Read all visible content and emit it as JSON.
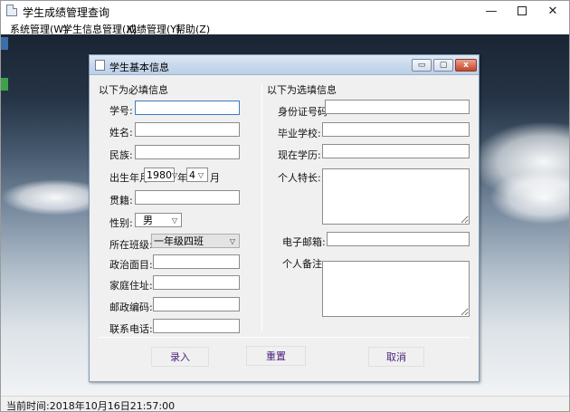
{
  "window": {
    "title": "学生成绩管理查询",
    "min_glyph": "—",
    "close_glyph": "✕"
  },
  "menu": [
    {
      "label": "系统管理(W)"
    },
    {
      "label": "学生信息管理(X)"
    },
    {
      "label": "成绩管理(Y)"
    },
    {
      "label": "帮助(Z)"
    }
  ],
  "dialog": {
    "title": "学生基本信息",
    "required_title": "以下为必填信息",
    "optional_title": "以下为选填信息",
    "btn_min": "▭",
    "btn_max": "▢",
    "btn_close": "x"
  },
  "form": {
    "student_id_label": "学号:",
    "name_label": "姓名:",
    "ethnicity_label": "民族:",
    "birth_label": "出生年月",
    "birth_year": "1980",
    "year_suffix": "年",
    "birth_month": "4",
    "month_suffix": "月",
    "native_place_label": "贯籍:",
    "gender_label": "性别:",
    "gender_value": "男",
    "class_label": "所在班级:",
    "class_value": "一年级四班",
    "political_label": "政治面目:",
    "address_label": "家庭住址:",
    "postcode_label": "邮政编码:",
    "phone_label": "联系电话:",
    "id_card_label": "身份证号码",
    "school_label": "毕业学校:",
    "education_label": "现在学历:",
    "specialty_label": "个人特长:",
    "email_label": "电子邮箱:",
    "remark_label": "个人备注:"
  },
  "buttons": {
    "submit": "录入",
    "reset": "重置",
    "cancel": "取消"
  },
  "status": {
    "text": "当前时间:2018年10月16日21:57:00"
  }
}
